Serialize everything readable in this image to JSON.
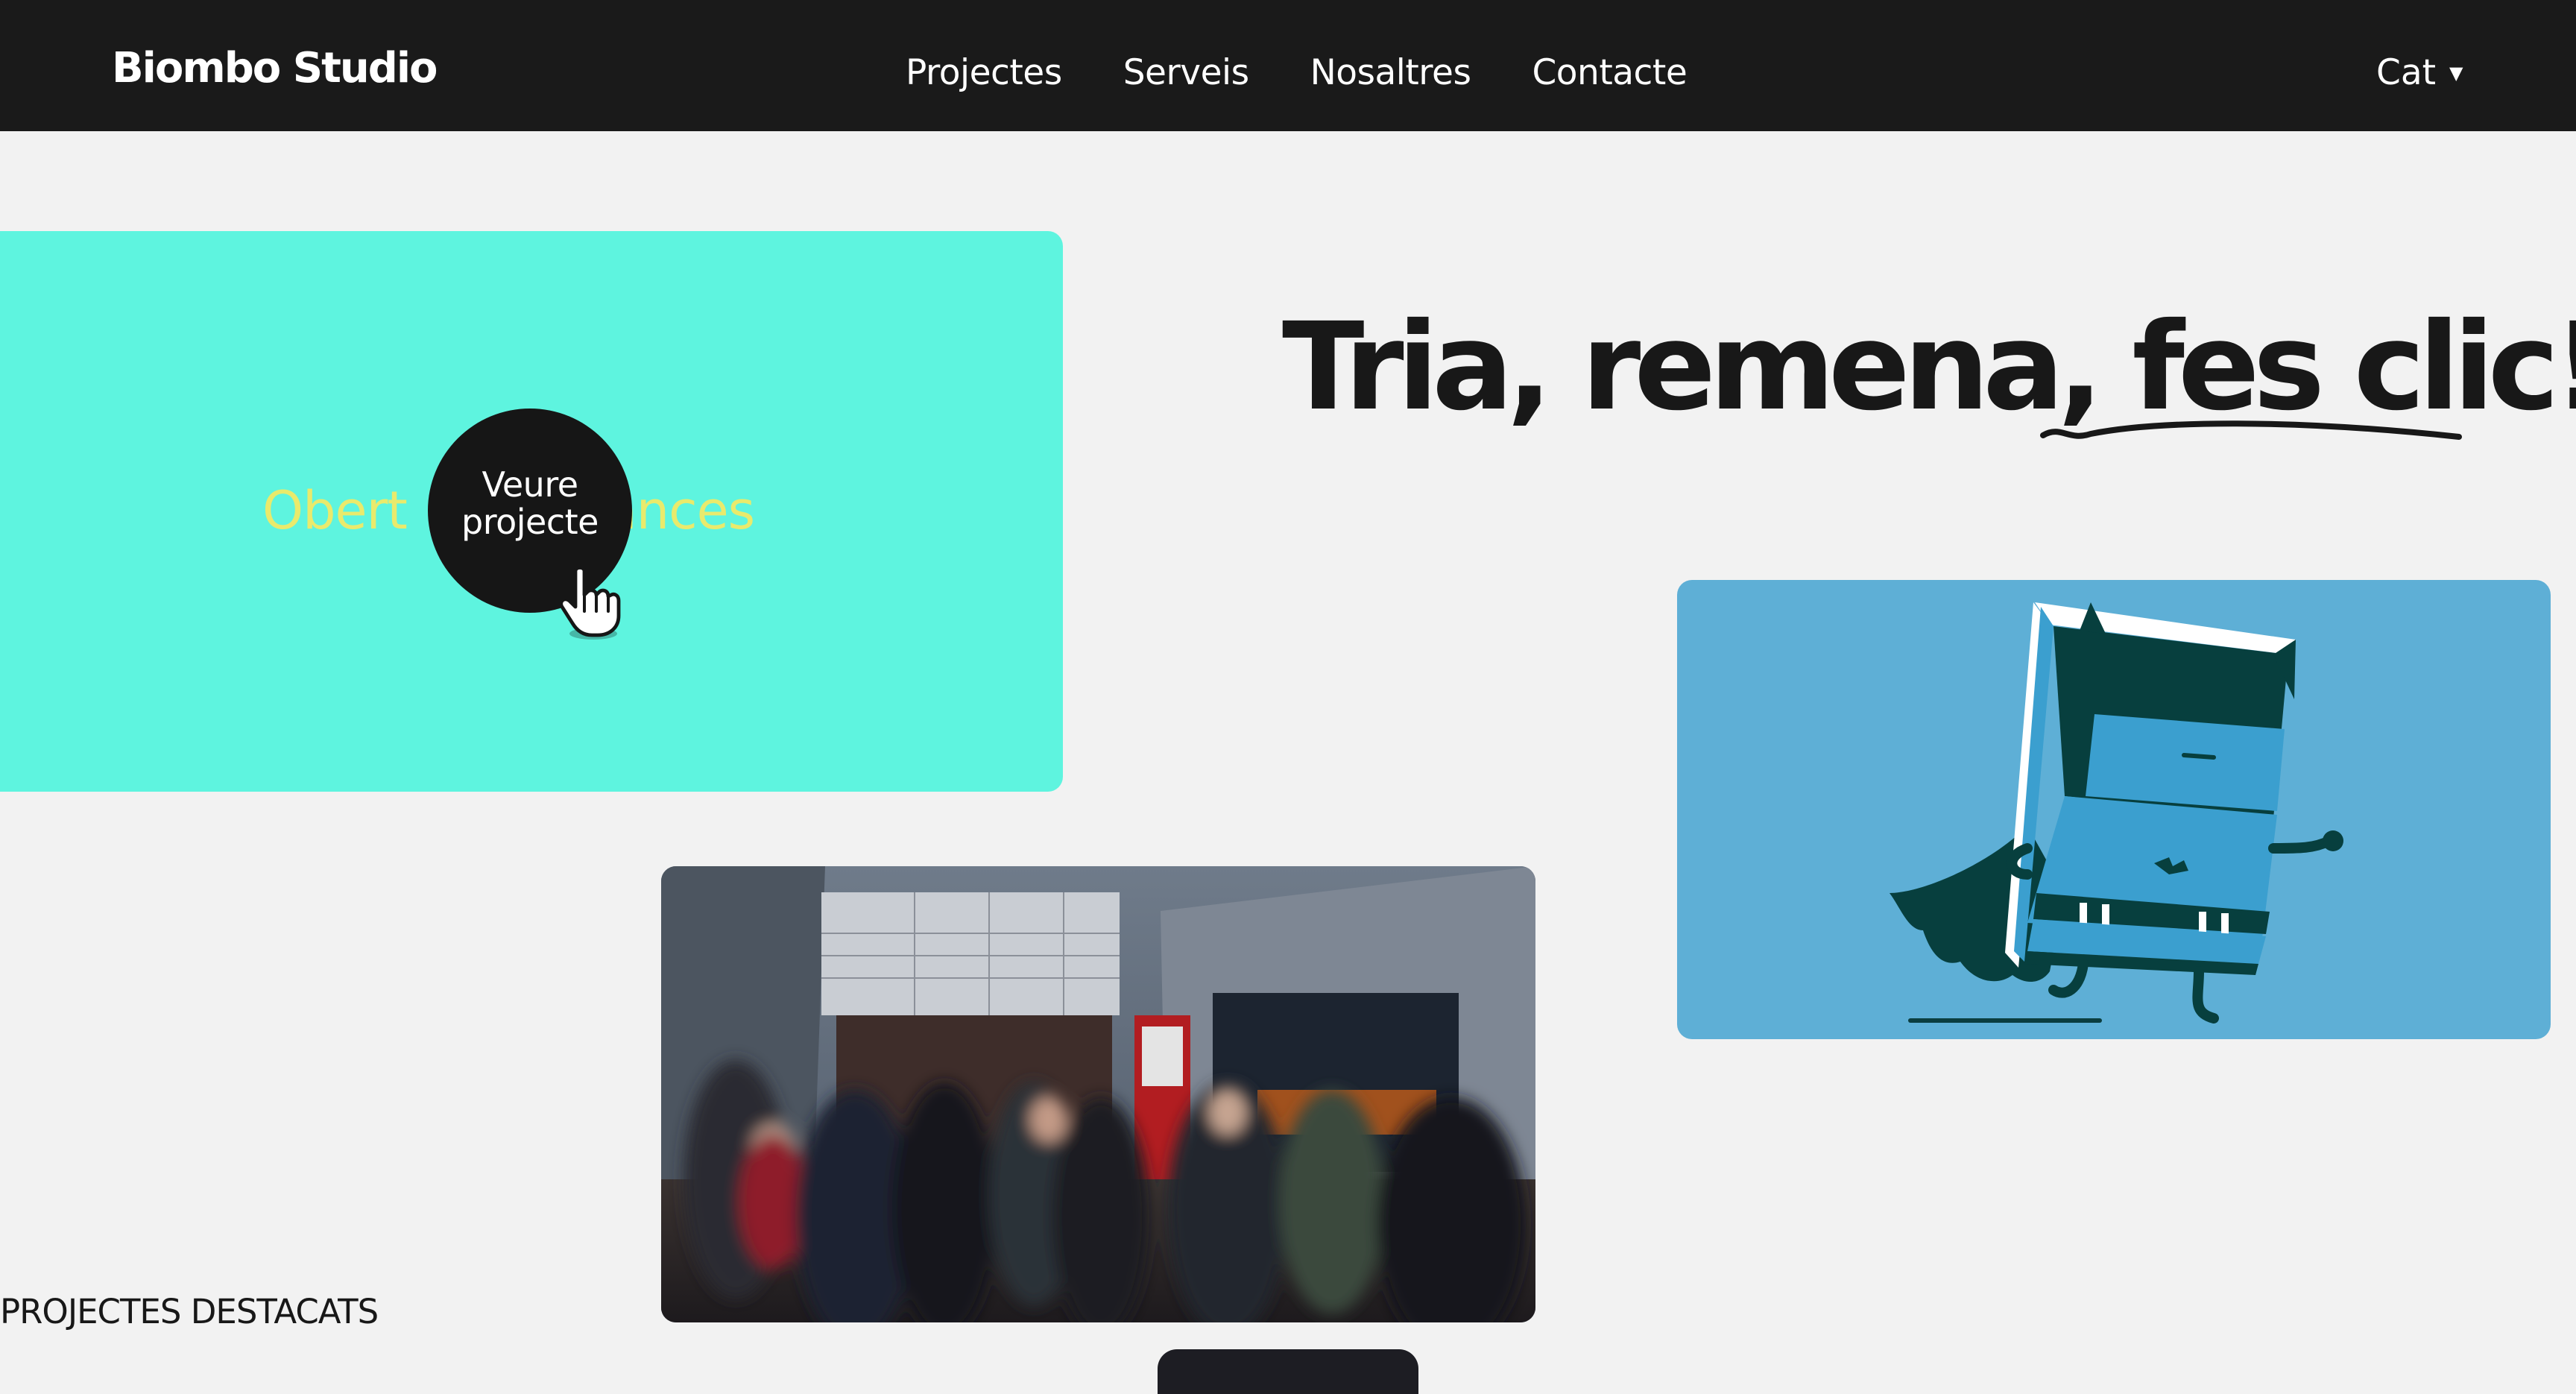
{
  "header": {
    "brand": "Biombo Studio",
    "nav": [
      {
        "label": "Projectes"
      },
      {
        "label": "Serveis"
      },
      {
        "label": "Nosaltres"
      },
      {
        "label": "Contacte"
      }
    ],
    "language": {
      "label": "Cat",
      "icon": "caret-down-icon"
    }
  },
  "hero": {
    "headline_plain": "Tria, remena, ",
    "headline_accent": "fes clic!"
  },
  "featured_card": {
    "text_left": "Obert",
    "text_right": "ances",
    "button_line1": "Veure",
    "button_line2": "projecte",
    "pointer_icon": "hand-pointer-icon",
    "background_color": "#5ef4df",
    "text_color": "#e9ea6c"
  },
  "cards": [
    {
      "kind": "illustration",
      "subject": "book-superhero-illustration",
      "background_color": "#5eafd6"
    },
    {
      "kind": "photo",
      "subject": "cinema-lobby-photo"
    }
  ],
  "section": {
    "label": "PROJECTES DESTACATS"
  },
  "colors": {
    "topbar": "#1a1a1a",
    "page_background": "#f2f2f2",
    "text": "#181818"
  }
}
